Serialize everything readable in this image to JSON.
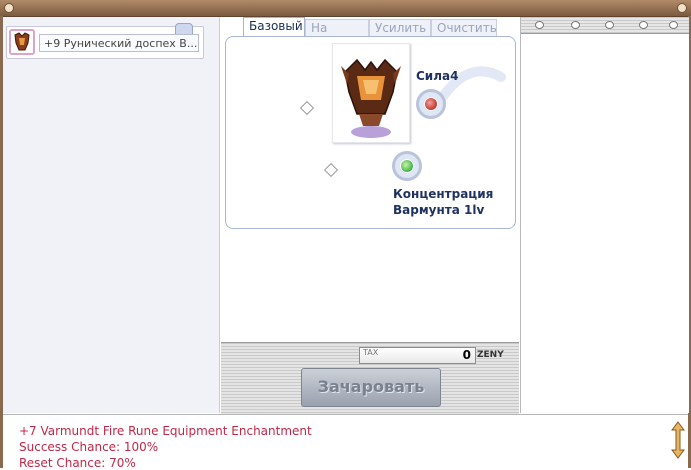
{
  "item_slot": {
    "name": "+9 Рунический доспех В..."
  },
  "tabs": [
    {
      "label": "Базовый",
      "active": true
    },
    {
      "label": "На выбор",
      "active": false
    },
    {
      "label": "Усилить",
      "active": false
    },
    {
      "label": "Очистить",
      "active": false
    }
  ],
  "enchants": [
    {
      "label": "Сила4",
      "orb_color": "#c0392b"
    },
    {
      "label_line1": "Концентрация",
      "label_line2": "Вармунта 1lv",
      "orb_color": "#3fb34a"
    }
  ],
  "tax": {
    "label": "TAX",
    "value": "0",
    "currency": "ZENY"
  },
  "enchant_button": {
    "label": "Зачаровать"
  },
  "description": {
    "lines": [
      "+7 Varmundt Fire Rune Equipment Enchantment",
      "Success Chance: 100%",
      "Reset Chance: 70%"
    ]
  },
  "colors": {
    "frame": "#8a6a4f",
    "description_text": "#c02848",
    "label_text": "#1f3261"
  }
}
